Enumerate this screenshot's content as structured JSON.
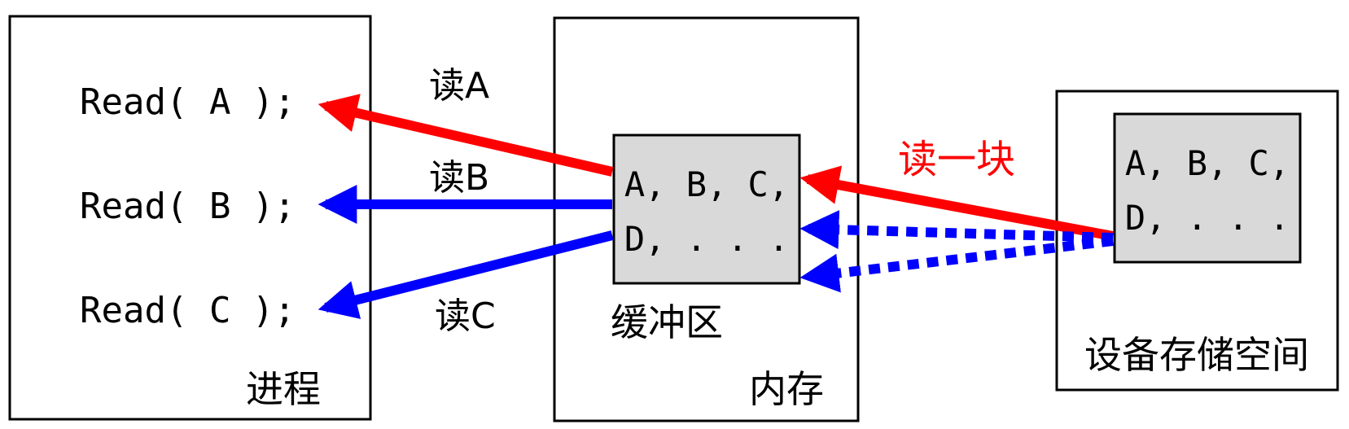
{
  "process": {
    "label": "进程",
    "calls": [
      "Read( A );",
      "Read( B );",
      "Read( C );"
    ]
  },
  "memory": {
    "label": "内存",
    "buffer_label": "缓冲区",
    "buffer_content": [
      "A, B, C,",
      "D, . . ."
    ]
  },
  "device": {
    "label": "设备存储空间",
    "content": [
      "A, B, C,",
      "D, . . ."
    ]
  },
  "arrows": {
    "read_a": "读A",
    "read_b": "读B",
    "read_c": "读C",
    "read_block": "读一块"
  },
  "colors": {
    "red": "#ff0000",
    "blue": "#0000ff",
    "gray": "#d9d9d9",
    "stroke": "#000000"
  }
}
